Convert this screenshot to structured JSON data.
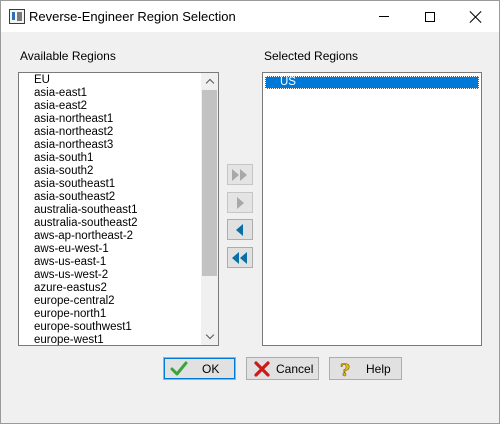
{
  "window": {
    "title": "Reverse-Engineer Region Selection"
  },
  "available": {
    "label": "Available Regions",
    "items": [
      "EU",
      "asia-east1",
      "asia-east2",
      "asia-northeast1",
      "asia-northeast2",
      "asia-northeast3",
      "asia-south1",
      "asia-south2",
      "asia-southeast1",
      "asia-southeast2",
      "australia-southeast1",
      "australia-southeast2",
      "aws-ap-northeast-2",
      "aws-eu-west-1",
      "aws-us-east-1",
      "aws-us-west-2",
      "azure-eastus2",
      "europe-central2",
      "europe-north1",
      "europe-southwest1",
      "europe-west1"
    ]
  },
  "selected": {
    "label": "Selected Regions",
    "items": [
      "US"
    ]
  },
  "move_buttons": [
    {
      "icon": "double-arrow-right-icon",
      "enabled": false
    },
    {
      "icon": "arrow-right-icon",
      "enabled": false
    },
    {
      "icon": "arrow-left-icon",
      "enabled": true
    },
    {
      "icon": "double-arrow-left-icon",
      "enabled": true
    }
  ],
  "buttons": {
    "ok": "OK",
    "cancel": "Cancel",
    "help": "Help"
  },
  "colors": {
    "selection": "#0078d7",
    "arrow_active": "#0a6ea8",
    "arrow_disabled": "#a8a8a8",
    "ok_check": "#3aa53a",
    "cancel_x": "#cc1a1a",
    "help_icon": "#e8c21a"
  }
}
